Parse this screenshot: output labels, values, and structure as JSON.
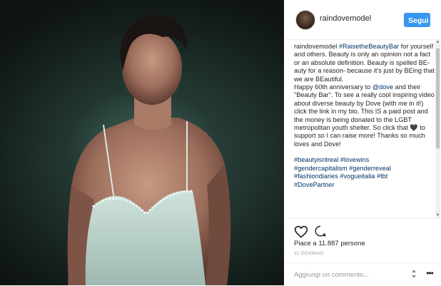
{
  "post": {
    "username": "raindovemodel",
    "follow_label": "Segui",
    "caption": {
      "username": "raindovemodel",
      "tag_raise": "#RaisetheBeautyBar",
      "text_1": " for yourself and others. Beauty is only an opinion not a fact or an absolute definition. Beauty is spelled BE-auty for a reason- because it's just by BEing that we are BEautiful.",
      "text_2": "Happy 60th anniversary to ",
      "mention": "@dove",
      "text_3": " and their \"Beauty Bar\". To see a really cool inspiring video about diverse beauty by Dove (with me in it!) click the link in my bio. This IS a paid post and the money is being donated to the LGBT metropolitan youth shelter. So click that 🖤 to support so I can raise more! Thanks so much loves and Dove!",
      "hashtags": [
        "#beautyisntreal",
        "#lovewins",
        "#gendercapitalism",
        "#genderreveal",
        "#fashiondiaries",
        "#vogueitalia",
        "#tbt",
        "#DovePartner"
      ]
    },
    "likes_text": "Piace a 11.887 persone",
    "date": "11 GENNAIO",
    "comment_placeholder": "Aggiungi un commento...",
    "options_label": "•••",
    "scroll_up": "▲",
    "scroll_down": "▼"
  },
  "icons": {
    "like": "heart-icon",
    "comment": "comment-icon",
    "more": "more-icon",
    "options": "options-icon"
  },
  "colors": {
    "follow_button": "#3897f0",
    "link": "#003569",
    "text": "#262626",
    "muted": "#999999"
  }
}
